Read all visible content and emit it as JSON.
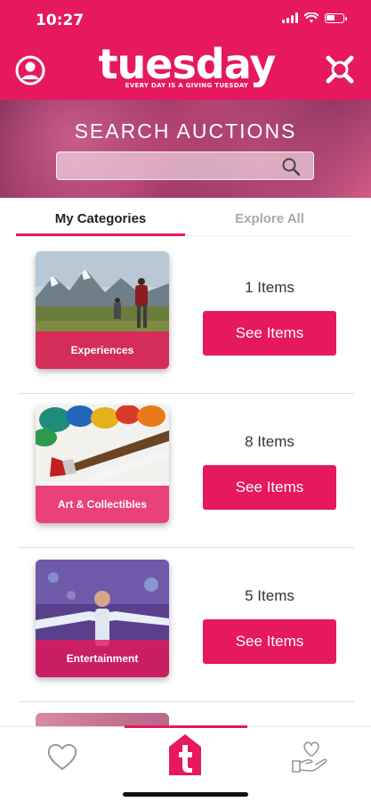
{
  "status_bar": {
    "time": "10:27",
    "battery_level": 0.5
  },
  "header": {
    "logo_word": "tuesday",
    "logo_tagline": "EVERY DAY IS A GIVING TUESDAY",
    "profile_icon": "user-circle-icon",
    "menu_icon": "bid-hands-icon",
    "brand_color": "#e6185f"
  },
  "search": {
    "title": "SEARCH AUCTIONS",
    "placeholder": "",
    "icon": "search-icon"
  },
  "tabs": [
    {
      "label": "My Categories",
      "active": true
    },
    {
      "label": "Explore All",
      "active": false
    }
  ],
  "categories": [
    {
      "name": "Experiences",
      "count_text": "1 Items",
      "button_label": "See Items"
    },
    {
      "name": "Art & Collectibles",
      "count_text": "8 Items",
      "button_label": "See Items"
    },
    {
      "name": "Entertainment",
      "count_text": "5 Items",
      "button_label": "See Items"
    }
  ],
  "bottom_nav": [
    {
      "icon": "heart-icon",
      "active": false
    },
    {
      "icon": "tuesday-home-icon",
      "active": true
    },
    {
      "icon": "giving-hand-icon",
      "active": false
    }
  ]
}
